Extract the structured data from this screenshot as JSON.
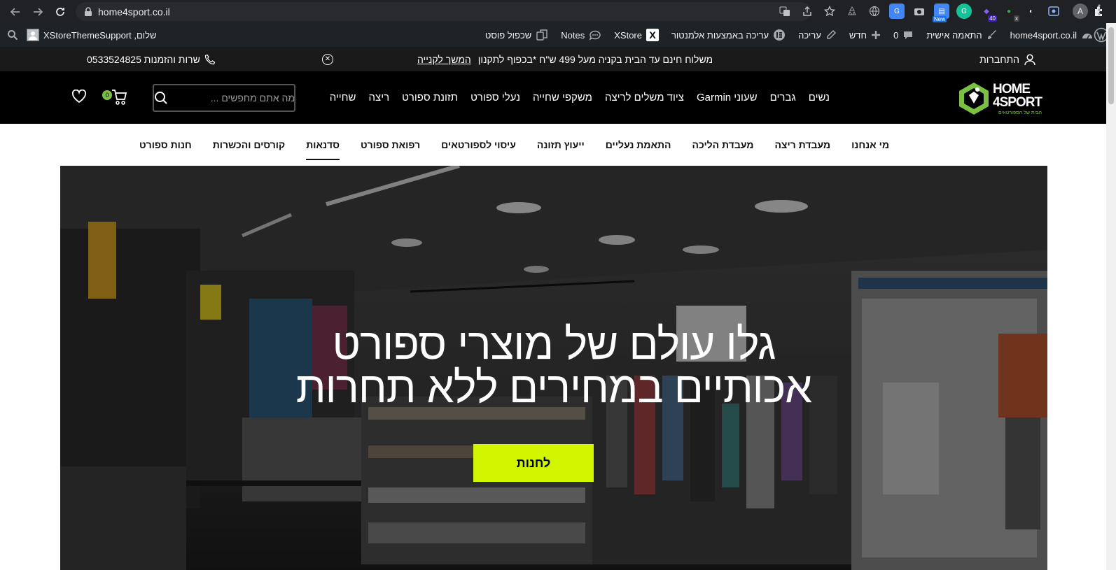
{
  "browser": {
    "url": "home4sport.co.il",
    "avatar_letter": "A",
    "extensions": [
      {
        "name": "translate-icon"
      },
      {
        "name": "share-icon"
      },
      {
        "name": "star-icon"
      },
      {
        "name": "recycle-icon"
      },
      {
        "name": "globe-icon"
      },
      {
        "name": "google-translate-icon"
      },
      {
        "name": "camera-icon"
      },
      {
        "name": "new-ext-icon",
        "badge": "New"
      },
      {
        "name": "grammarly-icon"
      },
      {
        "name": "ext-40-icon",
        "badge": "40"
      },
      {
        "name": "ext-x-icon",
        "badge": "x"
      },
      {
        "name": "ext-swirl-icon"
      },
      {
        "name": "screen-icon"
      },
      {
        "name": "pen-icon"
      },
      {
        "name": "puzzle-icon"
      },
      {
        "name": "sidebar-icon"
      }
    ]
  },
  "admin_bar": {
    "site_name": "home4sport.co.il",
    "customize": "התאמה אישית",
    "comments_count": "0",
    "new": "חדש",
    "edit": "עריכה",
    "elementor": "עריכה באמצעות אלמנטור",
    "xstore": "XStore",
    "notes": "Notes",
    "duplicate": "שכפול פוסט",
    "greeting": "שלום, XStoreThemeSupport"
  },
  "promo": {
    "login": "התחברות",
    "message": "משלוח חינם עד הבית בקניה מעל 499 ש\"ח *בכפוף לתקנון",
    "continue": "המשך לקנייה",
    "phone": "שרות והזמנות 0533524825"
  },
  "header": {
    "logo_line1": "HOME",
    "logo_line2": "4SPORT",
    "logo_tagline": "הבית של הספורטאים",
    "nav": [
      "נשים",
      "גברים",
      "שעוני Garmin",
      "ציוד משלים לריצה",
      "משקפי שחייה",
      "נעלי ספורט",
      "תזונת ספורט",
      "ריצה",
      "שחייה"
    ],
    "search_placeholder": "מה אתם מחפשים ...",
    "cart_count": "0"
  },
  "subnav": {
    "items": [
      "מי אנחנו",
      "מעבדת ריצה",
      "מעבדת הליכה",
      "התאמת נעליים",
      "ייעוץ תזונה",
      "עיסוי לספורטאים",
      "רפואת ספורט",
      "סדנאות",
      "קורסים והכשרות",
      "חנות ספורט"
    ],
    "active": "סדנאות"
  },
  "hero": {
    "title_line1": "גלו עולם של מוצרי ספורט",
    "title_line2": "אכותיים במחירים ללא תחרות",
    "cta": "לחנות"
  },
  "colors": {
    "accent": "#d1f600",
    "logo_green": "#7ac143",
    "header_bg": "#000000",
    "wpbar_bg": "#1d2327"
  }
}
